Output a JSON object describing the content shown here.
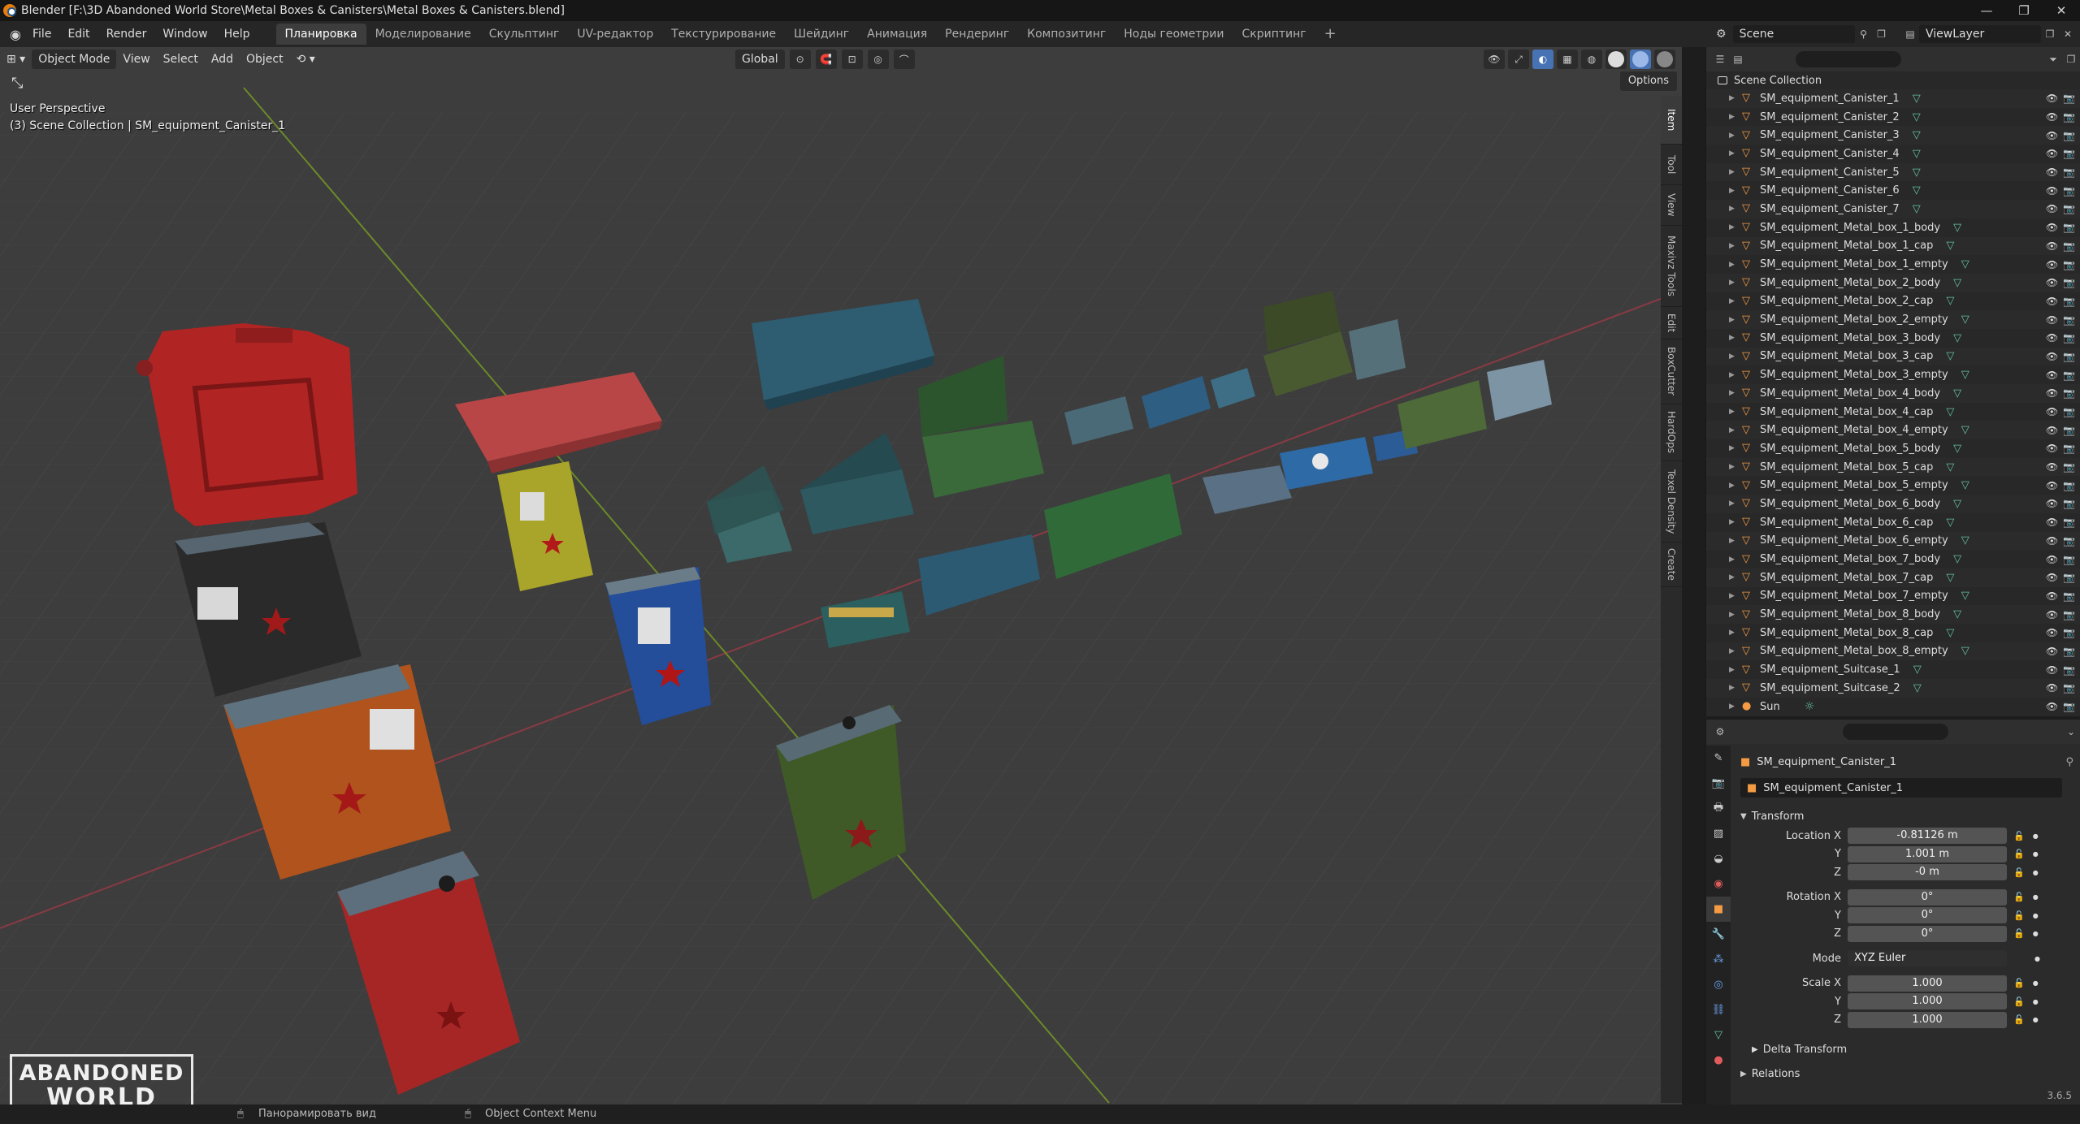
{
  "window": {
    "title": "Blender [F:\\3D Abandoned World Store\\Metal Boxes & Canisters\\Metal Boxes & Canisters.blend]",
    "controls": [
      "—",
      "❐",
      "✕"
    ]
  },
  "menu": {
    "items": [
      "File",
      "Edit",
      "Render",
      "Window",
      "Help"
    ],
    "workspaces": [
      "Планировка",
      "Моделирование",
      "Скульптинг",
      "UV-редактор",
      "Текстурирование",
      "Шейдинг",
      "Анимация",
      "Рендеринг",
      "Композитинг",
      "Ноды геометрии",
      "Скриптинг"
    ],
    "active_workspace": "Планировка",
    "add_workspace": "+"
  },
  "scene": {
    "label": "Scene"
  },
  "view_layer": {
    "label": "ViewLayer"
  },
  "viewport": {
    "mode": "Object Mode",
    "menus": [
      "View",
      "Select",
      "Add",
      "Object"
    ],
    "orientation": "Global",
    "options": "Options",
    "perspective": "User Perspective",
    "collection_info": "(3) Scene Collection | SM_equipment_Canister_1",
    "side_tabs": [
      "Item",
      "Tool",
      "View",
      "Maxivz Tools",
      "Edit",
      "BoxCutter",
      "HardOps",
      "Texel Density",
      "Create"
    ],
    "logo_line1": "ABANDONED",
    "logo_line2": "WORLD"
  },
  "outliner": {
    "search_placeholder": "",
    "collection": "Scene Collection",
    "objects": [
      "SM_equipment_Canister_1",
      "SM_equipment_Canister_2",
      "SM_equipment_Canister_3",
      "SM_equipment_Canister_4",
      "SM_equipment_Canister_5",
      "SM_equipment_Canister_6",
      "SM_equipment_Canister_7",
      "SM_equipment_Metal_box_1_body",
      "SM_equipment_Metal_box_1_cap",
      "SM_equipment_Metal_box_1_empty",
      "SM_equipment_Metal_box_2_body",
      "SM_equipment_Metal_box_2_cap",
      "SM_equipment_Metal_box_2_empty",
      "SM_equipment_Metal_box_3_body",
      "SM_equipment_Metal_box_3_cap",
      "SM_equipment_Metal_box_3_empty",
      "SM_equipment_Metal_box_4_body",
      "SM_equipment_Metal_box_4_cap",
      "SM_equipment_Metal_box_4_empty",
      "SM_equipment_Metal_box_5_body",
      "SM_equipment_Metal_box_5_cap",
      "SM_equipment_Metal_box_5_empty",
      "SM_equipment_Metal_box_6_body",
      "SM_equipment_Metal_box_6_cap",
      "SM_equipment_Metal_box_6_empty",
      "SM_equipment_Metal_box_7_body",
      "SM_equipment_Metal_box_7_cap",
      "SM_equipment_Metal_box_7_empty",
      "SM_equipment_Metal_box_8_body",
      "SM_equipment_Metal_box_8_cap",
      "SM_equipment_Metal_box_8_empty",
      "SM_equipment_Suitcase_1",
      "SM_equipment_Suitcase_2",
      "Sun"
    ]
  },
  "properties": {
    "object_name": "SM_equipment_Canister_1",
    "name_field": "SM_equipment_Canister_1",
    "transform_label": "Transform",
    "location_label": "Location X",
    "rotation_label": "Rotation X",
    "scale_label": "Scale X",
    "y_label": "Y",
    "z_label": "Z",
    "location": [
      "-0.81126 m",
      "1.001 m",
      "-0 m"
    ],
    "rotation": [
      "0°",
      "0°",
      "0°"
    ],
    "mode_label": "Mode",
    "mode_value": "XYZ Euler",
    "scale": [
      "1.000",
      "1.000",
      "1.000"
    ],
    "delta_transform": "Delta Transform",
    "relations": "Relations",
    "version": "3.6.5"
  },
  "statusbar": {
    "pan_hint": "Панорамировать вид",
    "context_menu_hint": "Object Context Menu"
  },
  "colors": {
    "accent": "#4772b3",
    "object_icon": "#f49b43",
    "mesh_icon": "#63c2a1",
    "selected_row": "#334d80",
    "viewport_bg": "#3d3d3d"
  }
}
